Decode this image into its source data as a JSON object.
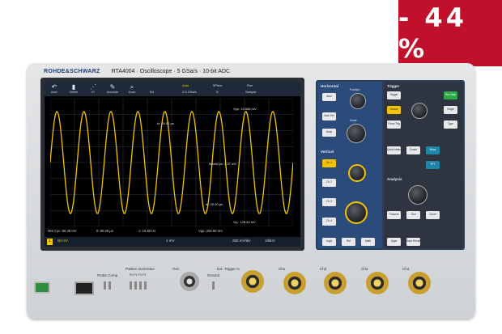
{
  "badge": {
    "text": "- 44 %"
  },
  "header": {
    "brand": "ROHDE&SCHWARZ",
    "model": "RTA4004 · Oscilloscope · 5 GSa/s · 10-bit ADC"
  },
  "toolbar": {
    "items": [
      {
        "label": "Undo",
        "icon": "undo-icon"
      },
      {
        "label": "Delete",
        "icon": "trash-icon"
      },
      {
        "label": "XY",
        "icon": "xy-icon"
      },
      {
        "label": "Annotate",
        "icon": "pen-icon"
      },
      {
        "label": "Zoom",
        "icon": "zoom-icon"
      }
    ],
    "readouts": [
      "D4",
      "2.5 GSa/s",
      "S",
      "Sample"
    ],
    "readout_heads": [
      "Auto",
      "5Pts/d",
      "Run"
    ]
  },
  "waveform": {
    "annotations": {
      "vpp": "Vpp: 10.686 mV",
      "mean": "MeanCyc: 2.37 mV",
      "vp": "Vp-: 125.84 mV",
      "t1": "tx: 25.00 µs",
      "t2": "dt: 25.00 µs"
    },
    "cycles": 9,
    "amplitude_fraction": 0.8
  },
  "status": {
    "left": "NIS Cyc: 80.48 mV",
    "mid1": "0: 80.08 µs",
    "mid2": "1: 10.80 Hz",
    "right": "Vpp: 254.90 mV"
  },
  "channel_bar": {
    "ch1": "1",
    "scale": "50 mV",
    "timebase": "1 mV",
    "trig": "250 mV/div",
    "rate": "10kHz"
  },
  "panel": {
    "horizontal": "Horizontal",
    "vertical": "Vertical",
    "analysis": "Analysis",
    "trigger": "Trigger",
    "position": "Position",
    "scale": "Scale",
    "keys_left": [
      "Auto",
      "Auto Set",
      "Acqu",
      "Ch 1",
      "Ch 2",
      "Ch 3",
      "Ch 4",
      "Logic",
      "Ref",
      "Math"
    ],
    "keys_right": [
      "Trigger",
      "Run Stop",
      "Source",
      "Single",
      "Force Trig",
      "Type",
      "Quick Meas",
      "Cursor",
      "Meas",
      "FFT",
      "Protocol",
      "Gen",
      "Zoom",
      "Apps",
      "Save Recall"
    ]
  },
  "front": {
    "pattern": "Pattern Generator",
    "probe": "Probe Comp",
    "gen": "Gen",
    "ext": "Ext. Trigger In",
    "ch": [
      "Ch1",
      "Ch2",
      "Ch3",
      "Ch4"
    ],
    "patterns": "P0 P1 P2 P3",
    "ground": "Ground"
  },
  "colors": {
    "waveform": "#f2c400",
    "badge": "#c0102c",
    "panel": "#2b4b7a"
  }
}
